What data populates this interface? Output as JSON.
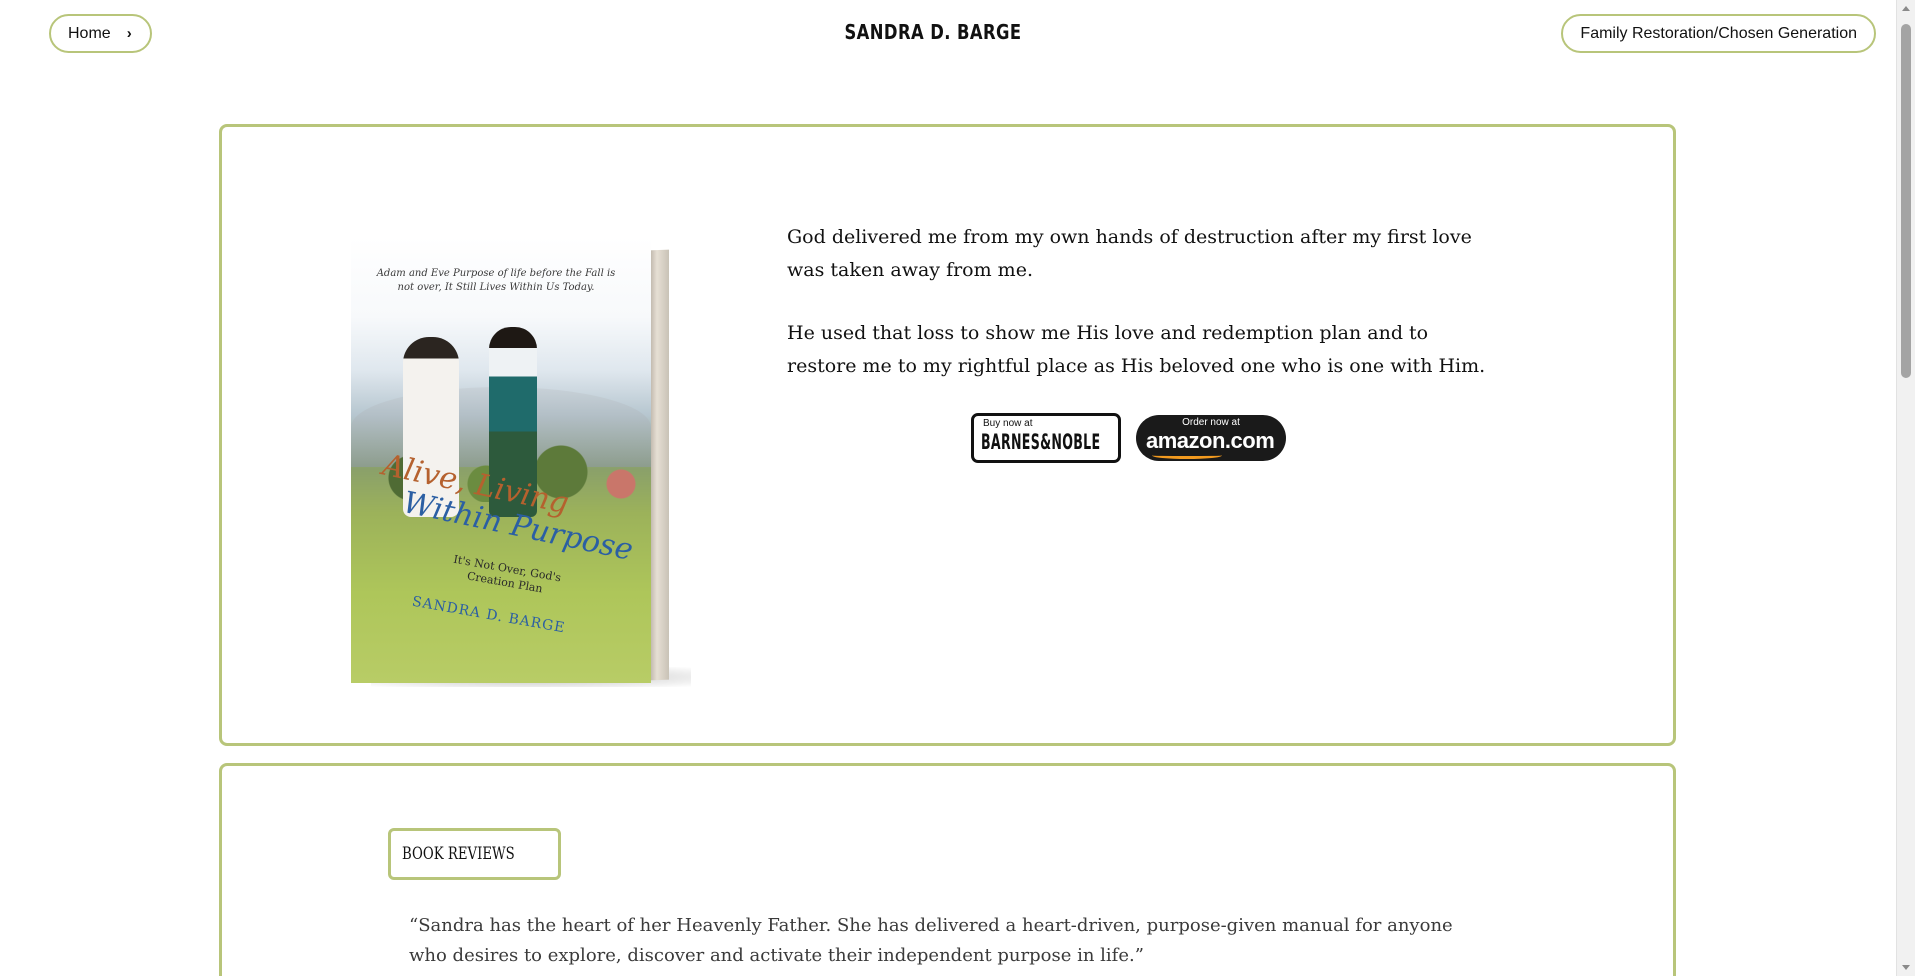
{
  "header": {
    "home_label": "Home",
    "chevron": "›",
    "site_title": "SANDRA D. BARGE",
    "family_link": "Family Restoration/Chosen Generation"
  },
  "hero": {
    "book": {
      "tagline": "Adam and Eve Purpose of life before the Fall is not over, It Still Lives Within Us Today.",
      "title_line1": "Alive, Living",
      "title_line2": "Within Purpose",
      "subtitle": "It's Not Over, God's Creation Plan",
      "author": "SANDRA D. BARGE"
    },
    "paragraph1": "God delivered me from my own hands of destruction after my first love was taken away from me.",
    "paragraph2": "He used that loss to show me His love and redemption plan and to restore me to my rightful place as His beloved one who is one with Him.",
    "barnes_small": "Buy now at",
    "barnes_big": "BARNES&NOBLE",
    "amazon_small": "Order now at",
    "amazon_big": "amazon.com ›"
  },
  "reviews": {
    "label": "BOOK REVIEWS",
    "quote": "“Sandra has the heart of her Heavenly Father. She has delivered a heart-driven, purpose-given manual for anyone who desires to explore, discover and activate their independent purpose in life.”"
  },
  "icons": {
    "chevron": "chevron-right-icon",
    "scroll_up": "arrow-up-icon",
    "scroll_down": "arrow-down-icon"
  },
  "colors": {
    "accent_border": "#b8c57a",
    "text": "#111111",
    "review_text": "#3a3a3a",
    "amazon_bg": "#1a1a1a",
    "amazon_smile": "#f29a1f"
  }
}
